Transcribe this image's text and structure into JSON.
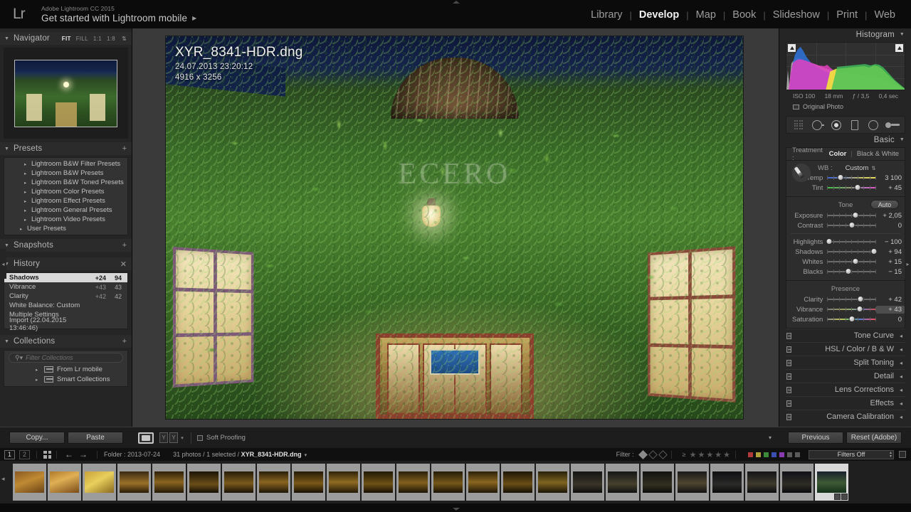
{
  "app": {
    "brand_small": "Adobe Lightroom CC 2015",
    "brand_logo": "Lr",
    "identity_plate": "Get started with Lightroom mobile",
    "identity_caret": "▶"
  },
  "modules": [
    {
      "label": "Library",
      "active": false
    },
    {
      "label": "Develop",
      "active": true
    },
    {
      "label": "Map",
      "active": false
    },
    {
      "label": "Book",
      "active": false
    },
    {
      "label": "Slideshow",
      "active": false
    },
    {
      "label": "Print",
      "active": false
    },
    {
      "label": "Web",
      "active": false
    }
  ],
  "module_separator": "|",
  "left_panel": {
    "navigator": {
      "title": "Navigator",
      "twisty": "▼",
      "modes": [
        "FIT",
        "FILL",
        "1:1",
        "1:8"
      ],
      "active_mode": "FIT",
      "updown": "⇅"
    },
    "presets": {
      "title": "Presets",
      "twisty": "▼",
      "add_label": "+",
      "items": [
        "Lightroom B&W Filter Presets",
        "Lightroom B&W Presets",
        "Lightroom B&W Toned Presets",
        "Lightroom Color Presets",
        "Lightroom Effect Presets",
        "Lightroom General Presets",
        "Lightroom Video Presets",
        "User Presets"
      ]
    },
    "snapshots": {
      "title": "Snapshots",
      "twisty": "▼",
      "add_label": "+"
    },
    "history": {
      "title": "History",
      "twisty": "▼",
      "clear_label": "✕",
      "items": [
        {
          "name": "Shadows",
          "delta": "+24",
          "value": "94",
          "selected": true
        },
        {
          "name": "Vibrance",
          "delta": "+43",
          "value": "43",
          "selected": false
        },
        {
          "name": "Clarity",
          "delta": "+42",
          "value": "42",
          "selected": false
        },
        {
          "name": "White Balance: Custom",
          "delta": "",
          "value": "",
          "selected": false
        },
        {
          "name": "Multiple Settings",
          "delta": "",
          "value": "",
          "selected": false
        },
        {
          "name": "Import (22.04.2015 13:46:46)",
          "delta": "",
          "value": "",
          "selected": false
        }
      ]
    },
    "collections": {
      "title": "Collections",
      "twisty": "▼",
      "add_label": "+",
      "filter_placeholder": "Filter Collections",
      "filter_value": "",
      "items": [
        "From Lr mobile",
        "Smart Collections"
      ]
    },
    "buttons": {
      "copy": "Copy...",
      "paste": "Paste"
    }
  },
  "center": {
    "overlay": {
      "filename": "XYR_8341-HDR.dng",
      "datetime": "24.07.2013 23:20:12",
      "dimensions": "4916 x 3256"
    },
    "toolbar": {
      "soft_proofing_label": "Soft Proofing",
      "soft_proofing_checked": false,
      "before_after_labels": [
        "Y",
        "Y"
      ],
      "caret": "▾"
    }
  },
  "right_panel": {
    "histogram": {
      "title": "Histogram",
      "twisty": "▼",
      "exif": {
        "iso": "ISO 100",
        "focal": "18 mm",
        "aperture": "ƒ / 3,5",
        "shutter": "0,4 sec"
      },
      "original_photo_label": "Original Photo",
      "original_photo_checked": false
    },
    "tools": [
      "crop-overlay-icon",
      "spot-removal-icon",
      "red-eye-icon",
      "graduated-filter-icon",
      "radial-filter-icon",
      "adjustment-brush-icon"
    ],
    "basic": {
      "title": "Basic",
      "twisty": "▼",
      "treatment_label": "Treatment :",
      "treatment_options": [
        {
          "label": "Color",
          "active": true
        },
        {
          "label": "Black & White",
          "active": false
        }
      ],
      "wb_label": "WB :",
      "wb_value": "Custom",
      "wb_updown": "⇅",
      "tone_label": "Tone",
      "auto_label": "Auto",
      "presence_label": "Presence",
      "sliders": [
        {
          "label": "Temp",
          "value": "3 100",
          "pos": 27,
          "grad": "grad-temp",
          "highlight": false
        },
        {
          "label": "Tint",
          "value": "+ 45",
          "pos": 62,
          "grad": "grad-tint",
          "highlight": false
        },
        {
          "label": "Exposure",
          "value": "+ 2,05",
          "pos": 58,
          "grad": "",
          "highlight": false
        },
        {
          "label": "Contrast",
          "value": "0",
          "pos": 50,
          "grad": "",
          "highlight": false
        },
        {
          "label": "Highlights",
          "value": "− 100",
          "pos": 4,
          "grad": "",
          "highlight": false
        },
        {
          "label": "Shadows",
          "value": "+ 94",
          "pos": 95,
          "grad": "",
          "highlight": false
        },
        {
          "label": "Whites",
          "value": "+ 15",
          "pos": 57,
          "grad": "",
          "highlight": false
        },
        {
          "label": "Blacks",
          "value": "− 15",
          "pos": 43,
          "grad": "",
          "highlight": false
        },
        {
          "label": "Clarity",
          "value": "+ 42",
          "pos": 67,
          "grad": "",
          "highlight": false
        },
        {
          "label": "Vibrance",
          "value": "+ 43",
          "pos": 66,
          "grad": "grad-vib",
          "highlight": true
        },
        {
          "label": "Saturation",
          "value": "0",
          "pos": 50,
          "grad": "grad-sat",
          "highlight": false
        }
      ]
    },
    "collapsed_panels": [
      {
        "title": "Tone Curve",
        "arrow": "◂"
      },
      {
        "title": "HSL  /  Color  /  B & W",
        "arrow": "◂"
      },
      {
        "title": "Split Toning",
        "arrow": "◂"
      },
      {
        "title": "Detail",
        "arrow": "◂"
      },
      {
        "title": "Lens Corrections",
        "arrow": "◂"
      },
      {
        "title": "Effects",
        "arrow": "◂"
      },
      {
        "title": "Camera Calibration",
        "arrow": "◂"
      }
    ],
    "buttons": {
      "previous": "Previous",
      "reset": "Reset (Adobe)"
    }
  },
  "filmstrip_bar": {
    "page_current": "1",
    "page_second": "2",
    "back_arrow": "←",
    "forward_arrow": "→",
    "source": "Folder : 2013-07-24",
    "count_text": "31 photos / 1 selected / ",
    "selected_file": "XYR_8341-HDR.dng",
    "caret": "▾",
    "filter_label": "Filter :",
    "rating_gte": "≥",
    "star_glyph": "★",
    "star_count": 5,
    "color_swatches": [
      "#b03a3a",
      "#b0a03a",
      "#3a8a3a",
      "#3a4fb0",
      "#8a3ab0",
      "#5a5a5a",
      "#5a5a5a"
    ],
    "filters_off_label": "Filters Off"
  },
  "filmstrip": {
    "left_arrow": "◂",
    "thumbs": [
      {
        "grad": "linear-gradient(160deg,#8a5a22,#c08a33 45%,#6a4418)",
        "selected": false
      },
      {
        "grad": "linear-gradient(160deg,#b07a2a,#e0b055 40%,#7a4c18)",
        "selected": false
      },
      {
        "grad": "linear-gradient(150deg,#c9a23a,#e8cf5c 45%,#8a6a20)",
        "selected": false
      },
      {
        "grad": "linear-gradient(180deg,#3a2a12,#9a7028 55%,#2a1c0a)",
        "selected": false
      },
      {
        "grad": "linear-gradient(180deg,#2e2008,#8a6520 50%,#241a06)",
        "selected": false
      },
      {
        "grad": "linear-gradient(180deg,#1c1405,#6a4e18 60%,#140e04)",
        "selected": false
      },
      {
        "grad": "linear-gradient(180deg,#261c08,#7a5a1c 55%,#1a1206)",
        "selected": false
      },
      {
        "grad": "linear-gradient(180deg,#2a1e08,#8a6520 50%,#1e1606)",
        "selected": false
      },
      {
        "grad": "linear-gradient(180deg,#241a06,#7a5818 55%,#181004)",
        "selected": false
      },
      {
        "grad": "linear-gradient(180deg,#2e2208,#8f6a22 50%,#221806)",
        "selected": false
      },
      {
        "grad": "linear-gradient(180deg,#201806,#6e5216 58%,#160f04)",
        "selected": false
      },
      {
        "grad": "linear-gradient(180deg,#2a1f08,#82601e 52%,#1c1405)",
        "selected": false
      },
      {
        "grad": "linear-gradient(180deg,#241b07,#765818 55%,#191104)",
        "selected": false
      },
      {
        "grad": "linear-gradient(180deg,#2c2008,#8a6620 50%,#201706)",
        "selected": false
      },
      {
        "grad": "linear-gradient(180deg,#1e1606,#6a4e16 58%,#140e04)",
        "selected": false
      },
      {
        "grad": "linear-gradient(180deg,#282008,#7e6420 52%,#1c1505)",
        "selected": false
      },
      {
        "grad": "linear-gradient(180deg,#141414,#3a3428 60%,#0e0e0e)",
        "selected": false
      },
      {
        "grad": "linear-gradient(180deg,#161616,#46402c 58%,#101010)",
        "selected": false
      },
      {
        "grad": "linear-gradient(180deg,#121212,#32301f 62%,#0c0c0c)",
        "selected": false
      },
      {
        "grad": "linear-gradient(180deg,#1a1a1a,#4e4630 55%,#111111)",
        "selected": false
      },
      {
        "grad": "linear-gradient(180deg,#0f0f12,#2a2a28 60%,#0a0a0c)",
        "selected": false
      },
      {
        "grad": "linear-gradient(180deg,#141418,#3e3a2c 58%,#0d0d10)",
        "selected": false
      },
      {
        "grad": "linear-gradient(180deg,#101018,#2e2c24 60%,#0a0a10)",
        "selected": false
      },
      {
        "grad": "linear-gradient(180deg,#18202e,#3e5a34 52%,#14301a)",
        "selected": true
      }
    ],
    "badges": [
      "crop-badge",
      "adjustment-badge"
    ]
  }
}
